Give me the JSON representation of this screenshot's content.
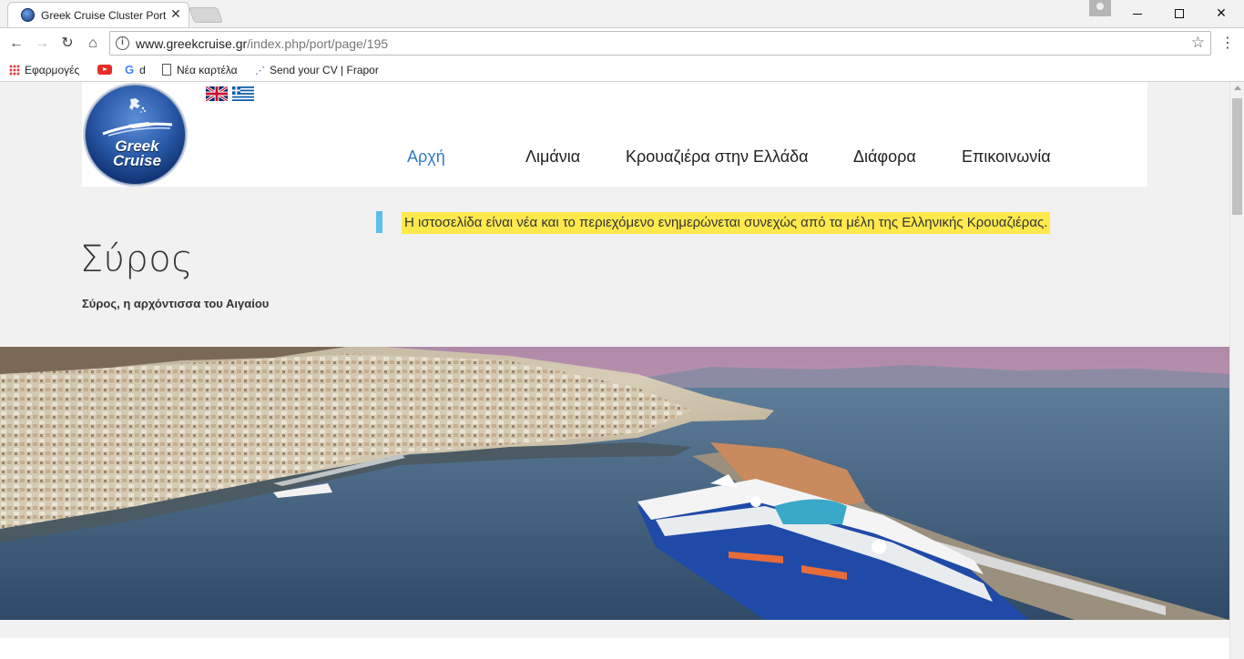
{
  "browser": {
    "tab_title": "Greek Cruise Cluster Port",
    "url_host": "www.greekcruise.gr",
    "url_path": "/index.php/port/page/195",
    "bookmarks": {
      "apps": "Εφαρμογές",
      "google": "d",
      "new_tab": "Νέα καρτέλα",
      "cv": "Send your CV | Frapor"
    }
  },
  "site": {
    "logo_line1": "Greek",
    "logo_line2": "Cruise",
    "nav": {
      "home": "Αρχή",
      "ports": "Λιμάνια",
      "cruise": "Κρουαζιέρα στην Ελλάδα",
      "misc": "Διάφορα",
      "contact": "Επικοινωνία"
    },
    "notice": "Η ιστοσελίδα είναι νέα και το περιεχόμενο ενημερώνεται συνεχώς από τα μέλη της Ελληνικής Κρουαζιέρας.",
    "port_title": "Σύρος",
    "port_subtitle": "Σύρος, η αρχόντισσα του Αιγαίου"
  },
  "colors": {
    "nav_active": "#2f7bc4",
    "notice_bg": "#ffe94d",
    "notice_accent": "#5bc0eb"
  }
}
